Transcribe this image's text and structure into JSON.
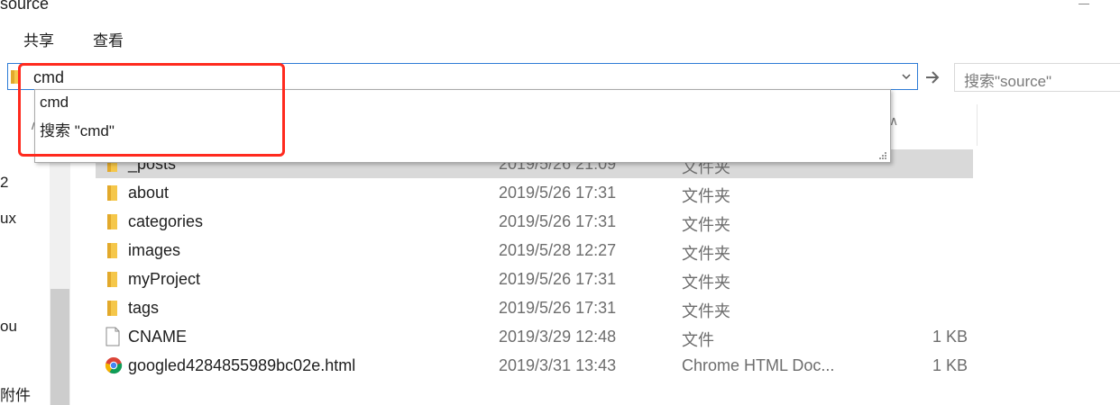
{
  "window": {
    "title": "source"
  },
  "ribbon": {
    "tabs": [
      "共享",
      "查看"
    ]
  },
  "address_bar": {
    "value": "cmd"
  },
  "search": {
    "placeholder": "搜索\"source\""
  },
  "autocomplete": {
    "items": [
      "cmd",
      "搜索 \"cmd\""
    ]
  },
  "nav_pane": {
    "labels": [
      "2",
      "ux",
      "ou",
      "附件"
    ]
  },
  "files": [
    {
      "name": "_posts",
      "date": "2019/5/26 21:09",
      "type": "文件夹",
      "size": "",
      "icon": "folder-icon"
    },
    {
      "name": "about",
      "date": "2019/5/26 17:31",
      "type": "文件夹",
      "size": "",
      "icon": "folder-icon"
    },
    {
      "name": "categories",
      "date": "2019/5/26 17:31",
      "type": "文件夹",
      "size": "",
      "icon": "folder-icon"
    },
    {
      "name": "images",
      "date": "2019/5/28 12:27",
      "type": "文件夹",
      "size": "",
      "icon": "folder-icon"
    },
    {
      "name": "myProject",
      "date": "2019/5/26 17:31",
      "type": "文件夹",
      "size": "",
      "icon": "folder-icon"
    },
    {
      "name": "tags",
      "date": "2019/5/26 17:31",
      "type": "文件夹",
      "size": "",
      "icon": "folder-icon"
    },
    {
      "name": "CNAME",
      "date": "2019/3/29 12:48",
      "type": "文件",
      "size": "1 KB",
      "icon": "file-icon"
    },
    {
      "name": "googled4284855989bc02e.html",
      "date": "2019/3/31 13:43",
      "type": "Chrome HTML Doc...",
      "size": "1 KB",
      "icon": "chrome-icon"
    }
  ],
  "colors": {
    "highlight": "#ff2a1e",
    "folder": "#f5c74a",
    "address_border": "#2d7bd6",
    "selected_row": "#d9d9d9"
  }
}
